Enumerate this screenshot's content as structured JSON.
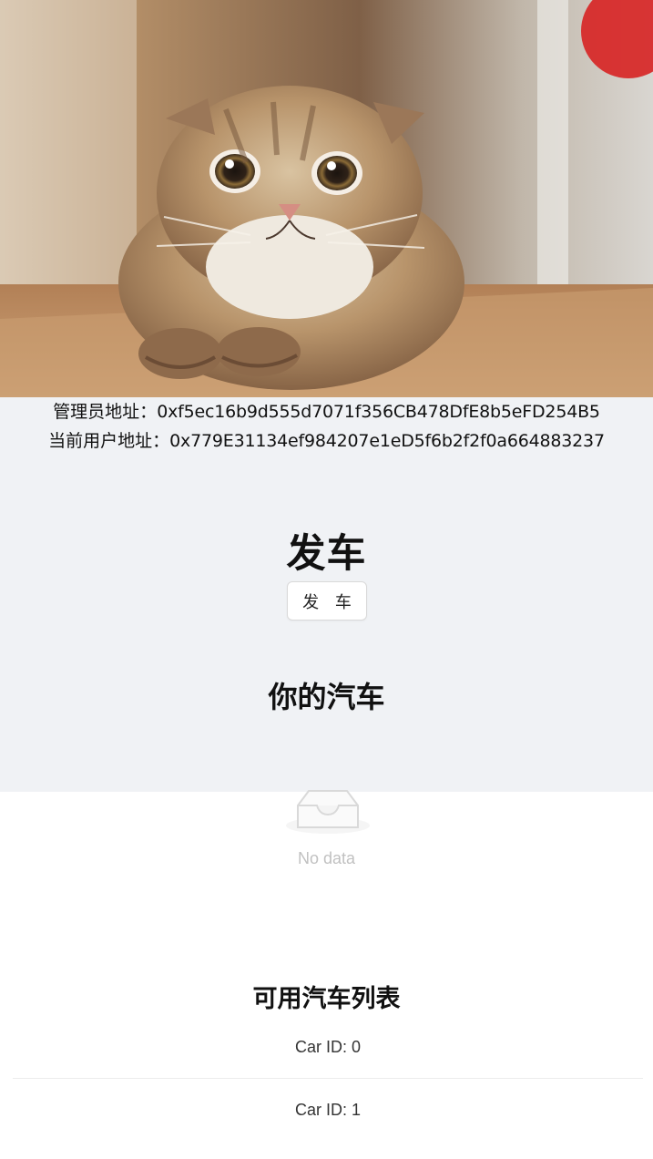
{
  "hero": {
    "image": "scared-scottish-fold-cat-photo"
  },
  "addresses": {
    "admin_label": "管理员地址：",
    "admin_value": "0xf5ec16b9d555d7071f356CB478DfE8b5eFD254B5",
    "user_label": "当前用户地址：",
    "user_value": "0x779E31134ef984207e1eD5f6b2f2f0a664883237"
  },
  "main": {
    "title": "发车",
    "launch_button_label": "发 车",
    "your_cars_title": "你的汽车",
    "empty_text": "No data",
    "available_title": "可用汽车列表"
  },
  "cars": [
    {
      "label": "Car ID: 0"
    },
    {
      "label": "Car ID: 1"
    }
  ],
  "icons": {
    "empty": "empty-box-icon"
  },
  "colors": {
    "gray_background": "#f0f2f5",
    "empty_text": "#c1c1c1",
    "button_border": "#d9d9d9"
  }
}
